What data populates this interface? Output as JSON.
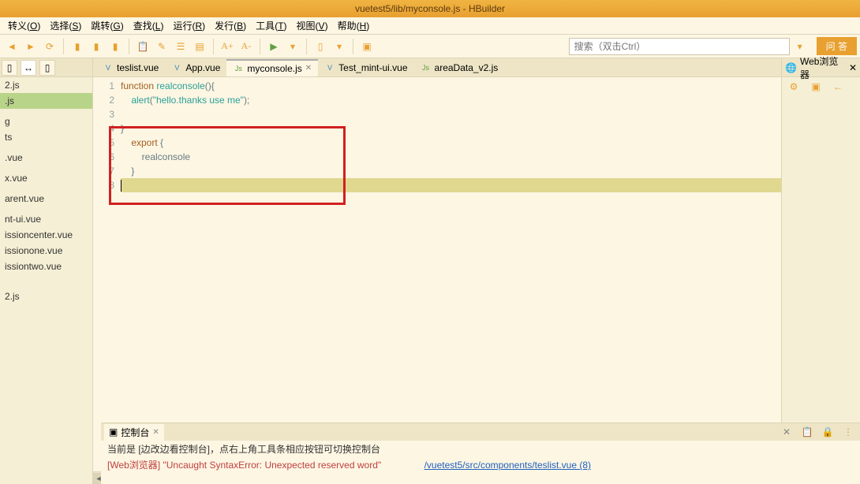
{
  "titlebar": "vuetest5/lib/myconsole.js - HBuilder",
  "menu": {
    "items": [
      {
        "label": "转义",
        "hotkey": "O"
      },
      {
        "label": "选择",
        "hotkey": "S"
      },
      {
        "label": "跳转",
        "hotkey": "G"
      },
      {
        "label": "查找",
        "hotkey": "L"
      },
      {
        "label": "运行",
        "hotkey": "R"
      },
      {
        "label": "发行",
        "hotkey": "B"
      },
      {
        "label": "工具",
        "hotkey": "T"
      },
      {
        "label": "视图",
        "hotkey": "V"
      },
      {
        "label": "帮助",
        "hotkey": "H"
      }
    ]
  },
  "toolbar": {
    "search_placeholder": "搜索（双击Ctrl）",
    "answer_btn": "问 答"
  },
  "file_list": [
    "2.js",
    ".js",
    "",
    "g",
    "ts",
    "",
    ".vue",
    "",
    "x.vue",
    "",
    "arent.vue",
    "",
    "nt-ui.vue",
    "issioncenter.vue",
    "issionone.vue",
    "issiontwo.vue",
    "",
    "",
    "",
    "2.js"
  ],
  "selected_file_index": 1,
  "editor_tabs": [
    {
      "name": "teslist.vue",
      "icon": "V",
      "icon_color": "blue"
    },
    {
      "name": "App.vue",
      "icon": "V",
      "icon_color": "blue"
    },
    {
      "name": "myconsole.js",
      "icon": "Js",
      "icon_color": "green",
      "active": true
    },
    {
      "name": "Test_mint-ui.vue",
      "icon": "V",
      "icon_color": "blue"
    },
    {
      "name": "areaData_v2.js",
      "icon": "Js",
      "icon_color": "green"
    }
  ],
  "code": {
    "line1_kw": "function",
    "line1_fn": " realconsole",
    "line1_end": "(){",
    "line2_fn": "    alert",
    "line2_p1": "(",
    "line2_str": "\"hello.thanks use me\"",
    "line2_p2": ");",
    "line3": "",
    "line4": "}",
    "line5_kw": "    export",
    "line5_rest": " {",
    "line6": "        realconsole",
    "line7": "    }",
    "line8": ""
  },
  "line_numbers": [
    "1",
    "2",
    "3",
    "4",
    "5",
    "6",
    "7",
    "8"
  ],
  "right_panel": {
    "tab": "Web浏览器"
  },
  "console": {
    "tab": "控制台",
    "hint": "当前是 [边改边看控制台]，点右上角工具条相应按钮可切换控制台",
    "line1_prefix": "[Web浏览器]",
    "line1_msg": " \"Uncaught SyntaxError: Unexpected reserved word\"",
    "line1_link": "/vuetest5/src/components/teslist.vue (8)"
  }
}
